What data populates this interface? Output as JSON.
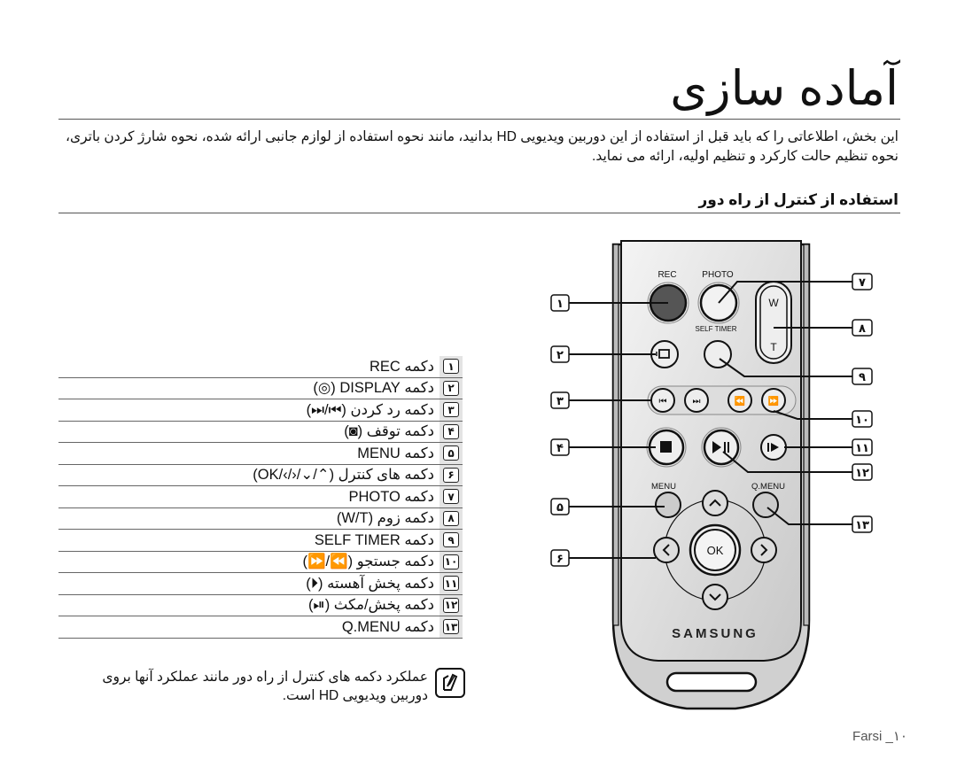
{
  "page": {
    "title": "آماده سازی",
    "intro": "این بخش، اطلاعاتی را که باید قبل از استفاده از این دوربین ویدیویی HD بدانید، مانند نحوه استفاده از لوازم جانبی ارائه شده، نحوه شارژ کردن باتری، نحوه تنظیم حالت کارکرد و تنظیم اولیه، ارائه می نماید.",
    "section_title": "استفاده از کنترل از راه دور",
    "footer": "Farsi _۱۰"
  },
  "button_list": [
    {
      "num": "۱",
      "label": "دکمه REC"
    },
    {
      "num": "۲",
      "label": "دکمه DISPLAY (◎)"
    },
    {
      "num": "۳",
      "label": "دکمه رد کردن (⏮/⏭)"
    },
    {
      "num": "۴",
      "label": "دکمه توقف (◙)"
    },
    {
      "num": "۵",
      "label": "دکمه MENU"
    },
    {
      "num": "۶",
      "label": "دکمه های کنترل (⌃/⌄/‹/›/OK)"
    },
    {
      "num": "۷",
      "label": "دکمه PHOTO"
    },
    {
      "num": "۸",
      "label": "دکمه زوم (W/T)"
    },
    {
      "num": "۹",
      "label": "دکمه SELF TIMER"
    },
    {
      "num": "۱۰",
      "label": "دکمه جستجو (⏪/⏩)"
    },
    {
      "num": "۱۱",
      "label": "دکمه پخش آهسته (⏵)"
    },
    {
      "num": "۱۲",
      "label": "دکمه پخش/مکث (⏯)"
    },
    {
      "num": "۱۳",
      "label": "دکمه Q.MENU"
    }
  ],
  "note": {
    "icon": "pencil-note-icon",
    "text": "عملکرد دکمه های کنترل از راه دور مانند عملکرد آنها بروی دوربین ویدیویی HD است."
  },
  "remote": {
    "labels": {
      "rec": "REC",
      "photo": "PHOTO",
      "self_timer": "SELF TIMER",
      "w": "W",
      "t": "T",
      "menu": "MENU",
      "qmenu": "Q.MENU",
      "ok": "OK",
      "brand": "SAMSUNG"
    },
    "callouts_left": [
      "۱",
      "۲",
      "۳",
      "۴",
      "۵",
      "۶"
    ],
    "callouts_right": [
      "۷",
      "۸",
      "۹",
      "۱۰",
      "۱۱",
      "۱۲",
      "۱۳"
    ],
    "colors": {
      "body": "#d4d4d4",
      "rec_button": "#555555",
      "outline": "#111111"
    }
  }
}
